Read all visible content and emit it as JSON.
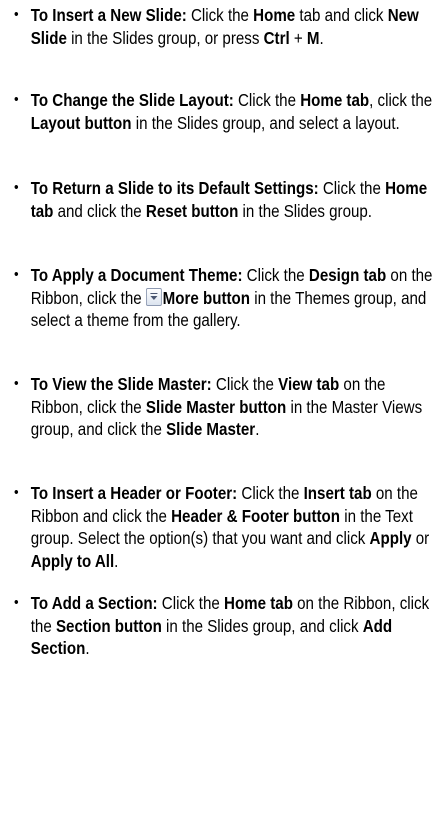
{
  "bullet_char": "•",
  "items": [
    {
      "title": "To Insert a New Slide:",
      "runs": [
        {
          "t": " Click the ",
          "b": false
        },
        {
          "t": "Home",
          "b": true
        },
        {
          "t": " tab and click ",
          "b": false
        },
        {
          "t": "New Slide",
          "b": true
        },
        {
          "t": " in the Slides group, or press ",
          "b": false
        },
        {
          "t": "Ctrl",
          "b": true
        },
        {
          "t": " + ",
          "b": false
        },
        {
          "t": "M",
          "b": true
        },
        {
          "t": ".",
          "b": false
        }
      ]
    },
    {
      "title": "To Change the Slide Layout:",
      "runs": [
        {
          "t": " Click the ",
          "b": false
        },
        {
          "t": "Home tab",
          "b": true
        },
        {
          "t": ", click the ",
          "b": false
        },
        {
          "t": "Layout button",
          "b": true
        },
        {
          "t": " in the Slides group, and select a layout.",
          "b": false
        }
      ]
    },
    {
      "title": "To Return a Slide to its Default Settings:",
      "runs": [
        {
          "t": " Click the ",
          "b": false
        },
        {
          "t": "Home tab",
          "b": true
        },
        {
          "t": " and click the ",
          "b": false
        },
        {
          "t": "Reset button",
          "b": true
        },
        {
          "t": " in the Slides group.",
          "b": false
        }
      ]
    },
    {
      "title": "To Apply a Document Theme:",
      "runs": [
        {
          "t": " Click the ",
          "b": false
        },
        {
          "t": "Design tab",
          "b": true
        },
        {
          "t": " on the Ribbon, click the ",
          "b": false
        },
        {
          "icon": "more-gallery-icon"
        },
        {
          "t": "More button",
          "b": true
        },
        {
          "t": " in the Themes group, and select a theme from the gallery.",
          "b": false
        }
      ]
    },
    {
      "title": "To View the Slide Master:",
      "runs": [
        {
          "t": " Click the ",
          "b": false
        },
        {
          "t": "View tab",
          "b": true
        },
        {
          "t": " on the Ribbon, click the ",
          "b": false
        },
        {
          "t": "Slide Master button",
          "b": true
        },
        {
          "t": " in the Master Views group, and click the ",
          "b": false
        },
        {
          "t": "Slide Master",
          "b": true
        },
        {
          "t": ".",
          "b": false
        }
      ]
    },
    {
      "title": "To Insert a Header or Footer:",
      "runs": [
        {
          "t": " Click the ",
          "b": false
        },
        {
          "t": "Insert tab",
          "b": true
        },
        {
          "t": " on the Ribbon and click the ",
          "b": false
        },
        {
          "t": "Header & Footer button",
          "b": true
        },
        {
          "t": " in the Text group. Select the option(s) that you want and click ",
          "b": false
        },
        {
          "t": "Apply",
          "b": true
        },
        {
          "t": " or ",
          "b": false
        },
        {
          "t": "Apply to All",
          "b": true
        },
        {
          "t": ".",
          "b": false
        }
      ]
    },
    {
      "title": "To Add a Section:",
      "runs": [
        {
          "t": " Click the ",
          "b": false
        },
        {
          "t": "Home tab",
          "b": true
        },
        {
          "t": " on the Ribbon, click the ",
          "b": false
        },
        {
          "t": "Section button",
          "b": true
        },
        {
          "t": " in the Slides group, and click ",
          "b": false
        },
        {
          "t": "Add Section",
          "b": true
        },
        {
          "t": ".",
          "b": false
        }
      ]
    }
  ]
}
